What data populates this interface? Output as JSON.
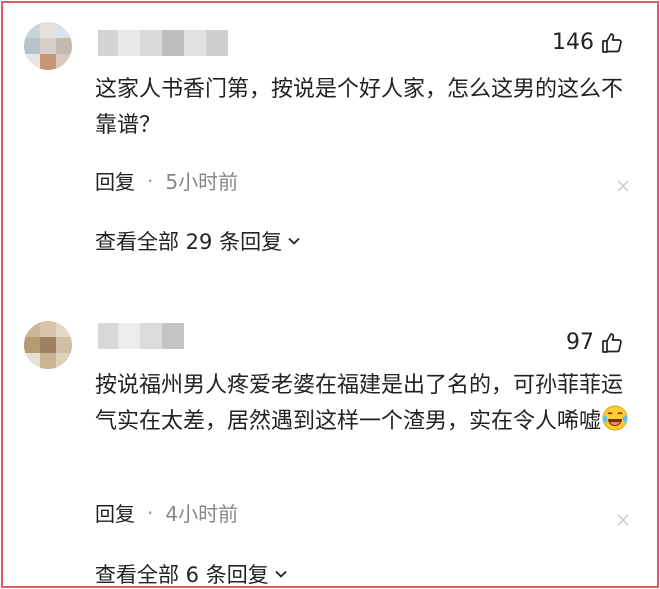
{
  "comments": [
    {
      "likes": "146",
      "text": "这家人书香门第，按说是个好人家，怎么这男的这么不靠谱？",
      "reply_label": "回复",
      "separator": "·",
      "time": "5小时前",
      "view_all_replies": "查看全部 29 条回复"
    },
    {
      "likes": "97",
      "text": "按说福州男人疼爱老婆在福建是出了名的，可孙菲菲运气实在太差，居然遇到这样一个渣男，实在令人唏嘘",
      "emoji": "laughing-tears-emoji",
      "reply_label": "回复",
      "separator": "·",
      "time": "4小时前",
      "view_all_replies": "查看全部 6 条回复"
    }
  ],
  "colors": {
    "frame_border": "#e05a5e",
    "text": "#222222",
    "meta_time": "#888888"
  },
  "icons": [
    "thumbs-up-icon",
    "close-icon",
    "chevron-down-icon"
  ]
}
